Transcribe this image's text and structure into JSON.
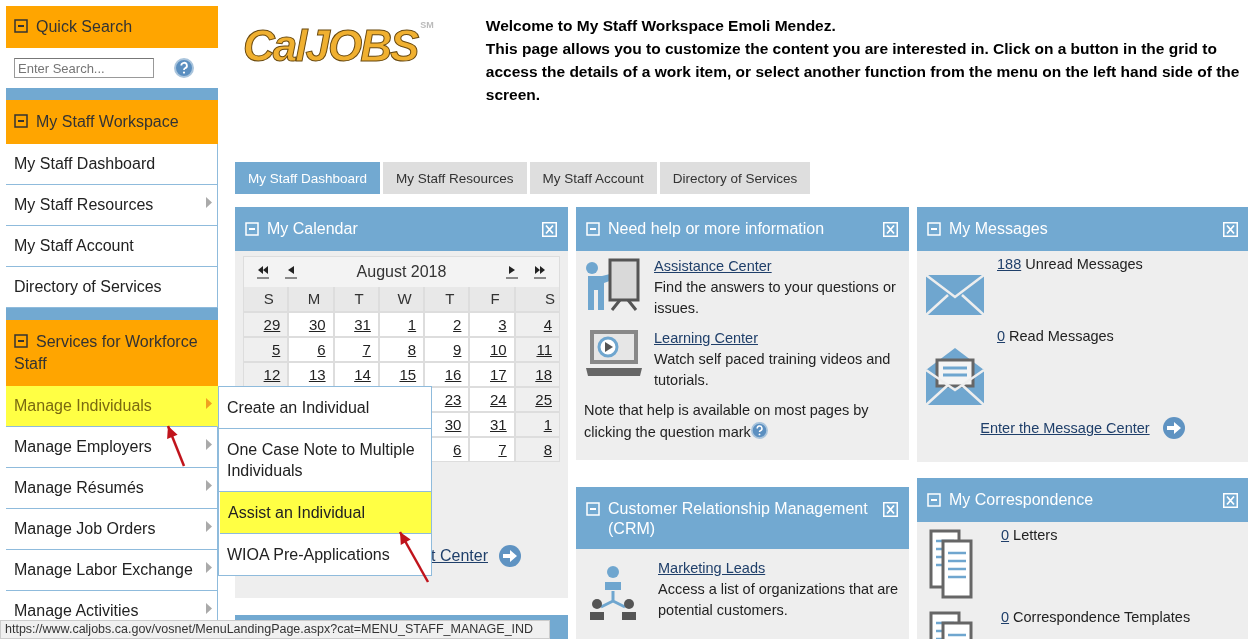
{
  "sidebar": {
    "sections": [
      {
        "kind": "search",
        "title": "Quick Search",
        "expanded": true,
        "search": {
          "placeholder": "Enter Search..."
        }
      },
      {
        "kind": "menu",
        "title": "My Staff Workspace",
        "expanded": true,
        "items": [
          {
            "label": "My Staff Dashboard",
            "has_submenu": false,
            "selected": false
          },
          {
            "label": "My Staff Resources",
            "has_submenu": true,
            "selected": false
          },
          {
            "label": "My Staff Account",
            "has_submenu": false,
            "selected": false
          },
          {
            "label": "Directory of Services",
            "has_submenu": false,
            "selected": false
          }
        ]
      },
      {
        "kind": "menu",
        "title": "Services for Workforce Staff",
        "expanded": true,
        "items": [
          {
            "label": "Manage Individuals",
            "has_submenu": true,
            "selected": true,
            "submenu": [
              {
                "label": "Create an Individual",
                "selected": false
              },
              {
                "label": "One Case Note to Multiple Individuals",
                "selected": false
              },
              {
                "label": "Assist an Individual",
                "selected": true
              },
              {
                "label": "WIOA Pre-Applications",
                "selected": false
              }
            ]
          },
          {
            "label": "Manage Employers",
            "has_submenu": true,
            "selected": false
          },
          {
            "label": "Manage Résumés",
            "has_submenu": true,
            "selected": false
          },
          {
            "label": "Manage Job Orders",
            "has_submenu": true,
            "selected": false
          },
          {
            "label": "Manage Labor Exchange",
            "has_submenu": true,
            "selected": false
          },
          {
            "label": "Manage Activities",
            "has_submenu": true,
            "selected": false
          }
        ]
      }
    ]
  },
  "header": {
    "logo": "CalJOBS",
    "logo_mark": "SM",
    "welcome": "Welcome to My Staff Workspace Emoli Mendez.",
    "intro": "This page allows you to customize the content you are interested in. Click on a button in the grid to access the details of a work item, or select another function from the menu on the left hand side of the screen."
  },
  "tabs": [
    {
      "label": "My Staff Dashboard",
      "selected": true
    },
    {
      "label": "My Staff Resources",
      "selected": false
    },
    {
      "label": "My Staff Account",
      "selected": false
    },
    {
      "label": "Directory of Services",
      "selected": false
    }
  ],
  "panel_columns": [
    {
      "panels": [
        {
          "kind": "calendar",
          "title": "My Calendar",
          "month": "August 2018",
          "weekdays": [
            "S",
            "M",
            "T",
            "W",
            "T",
            "F",
            "S"
          ],
          "weeks": [
            [
              "29",
              "30",
              "31",
              "1",
              "2",
              "3",
              "4"
            ],
            [
              "5",
              "6",
              "7",
              "8",
              "9",
              "10",
              "11"
            ],
            [
              "12",
              "13",
              "14",
              "15",
              "16",
              "17",
              "18"
            ],
            [
              "23",
              "24",
              "25"
            ],
            [
              "30",
              "31",
              "1"
            ],
            [
              "6",
              "7",
              "8"
            ]
          ],
          "footer_link": "t Center"
        },
        {
          "kind": "blank"
        }
      ]
    },
    {
      "panels": [
        {
          "kind": "help",
          "title": "Need help or more information",
          "entries": [
            {
              "kind": "presenter",
              "link": "Assistance Center",
              "text": "Find the answers to your questions or issues."
            },
            {
              "kind": "video",
              "link": "Learning Center",
              "text": "Watch self paced training videos and tutorials."
            }
          ],
          "note": "Note that help is available on most pages by clicking the question mark"
        },
        {
          "kind": "crm",
          "title": "Customer Relationship Management (CRM)",
          "entries": [
            {
              "kind": "people",
              "link": "Marketing Leads",
              "text": "Access a list of organizations that are potential customers."
            }
          ]
        }
      ]
    },
    {
      "panels": [
        {
          "kind": "messages",
          "title": "My Messages",
          "entries": [
            {
              "kind": "closed",
              "count": "188",
              "text": "Unread Messages"
            },
            {
              "kind": "open",
              "count": "0",
              "text": "Read Messages"
            }
          ],
          "footer_link": "Enter the Message Center"
        },
        {
          "kind": "correspondence",
          "title": "My Correspondence",
          "entries": [
            {
              "count": "0",
              "text": "Letters"
            },
            {
              "count": "0",
              "text": "Correspondence Templates"
            }
          ]
        }
      ]
    }
  ],
  "annotations": [
    {
      "kind": "arrow"
    },
    {
      "kind": "arrow"
    }
  ],
  "status_bar": {
    "url": "https://www.caljobs.ca.gov/vosnet/MenuLandingPage.aspx?cat=MENU_STAFF_MANAGE_IND"
  }
}
